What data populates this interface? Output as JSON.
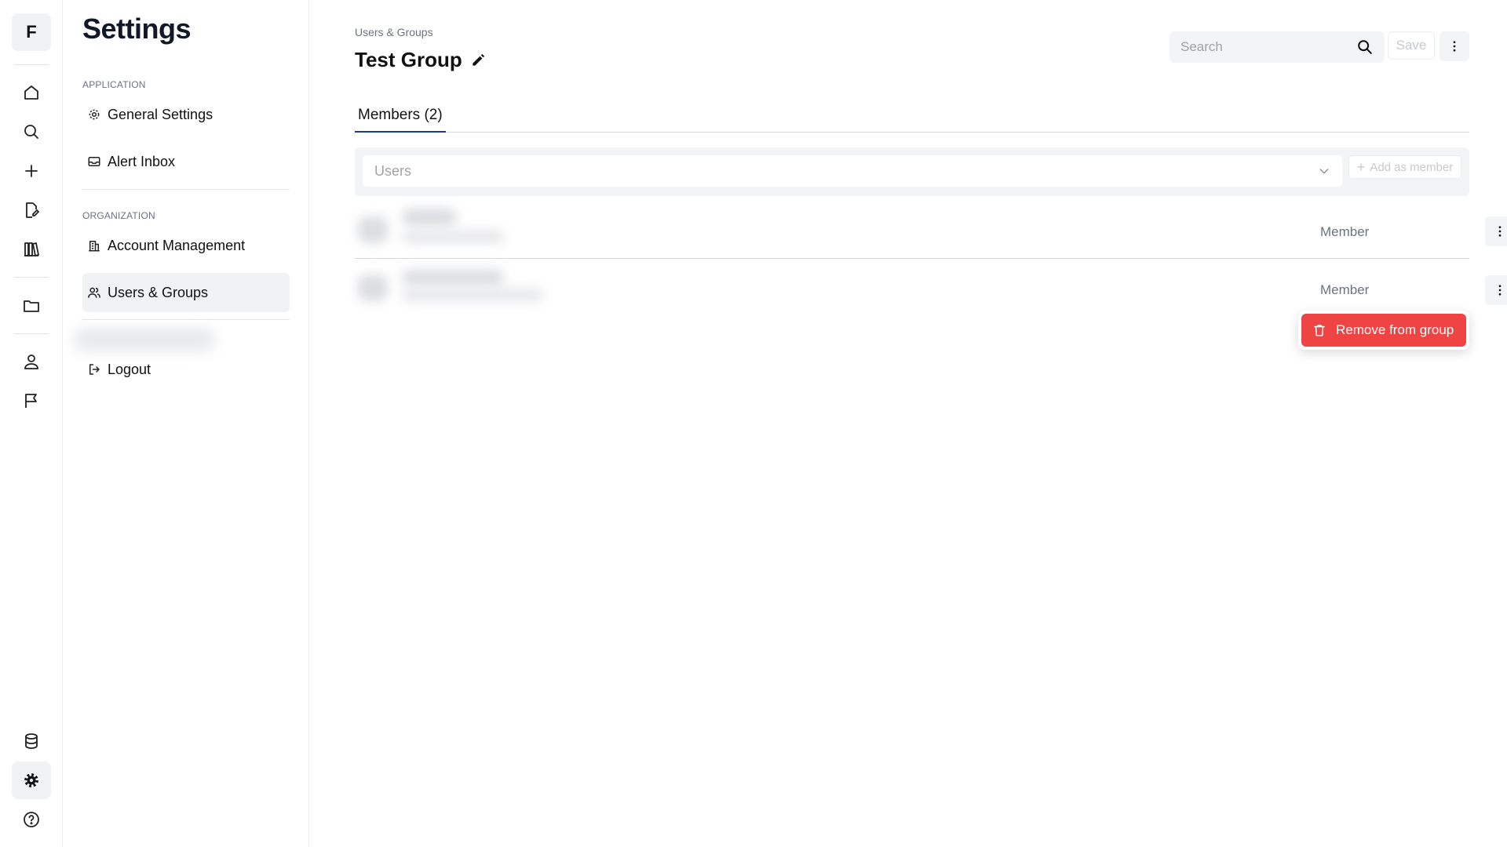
{
  "rail": {
    "logo_letter": "F",
    "items": [
      {
        "icon": "home-icon"
      },
      {
        "icon": "search-icon"
      },
      {
        "icon": "plus-icon"
      },
      {
        "icon": "edit-document-icon"
      },
      {
        "icon": "books-icon"
      },
      {
        "icon": "folder-icon"
      },
      {
        "icon": "user-icon"
      },
      {
        "icon": "flag-icon"
      },
      {
        "icon": "database-icon"
      },
      {
        "icon": "gear-icon",
        "active": true
      },
      {
        "icon": "help-icon"
      }
    ]
  },
  "settings_nav": {
    "title": "Settings",
    "sections": [
      {
        "label": "APPLICATION",
        "items": [
          {
            "label": "General Settings",
            "icon": "gear-icon"
          },
          {
            "label": "Alert Inbox",
            "icon": "inbox-icon"
          }
        ]
      },
      {
        "label": "ORGANIZATION",
        "items": [
          {
            "label": "Account Management",
            "icon": "building-icon"
          },
          {
            "label": "Users & Groups",
            "icon": "users-icon",
            "active": true
          }
        ]
      }
    ],
    "logout_label": "Logout"
  },
  "header": {
    "breadcrumb": "Users & Groups",
    "title": "Test Group",
    "search_placeholder": "Search",
    "save_label": "Save"
  },
  "tabs": [
    {
      "label": "Members (2)",
      "active": true
    }
  ],
  "add_member": {
    "select_placeholder": "Users",
    "button_label": "Add as member"
  },
  "members": [
    {
      "role": "Member"
    },
    {
      "role": "Member"
    }
  ],
  "context_menu": {
    "remove_label": "Remove from group"
  },
  "colors": {
    "accent": "#1f3a8a",
    "danger": "#ef4444",
    "active_bg": "#f1f2f4"
  }
}
